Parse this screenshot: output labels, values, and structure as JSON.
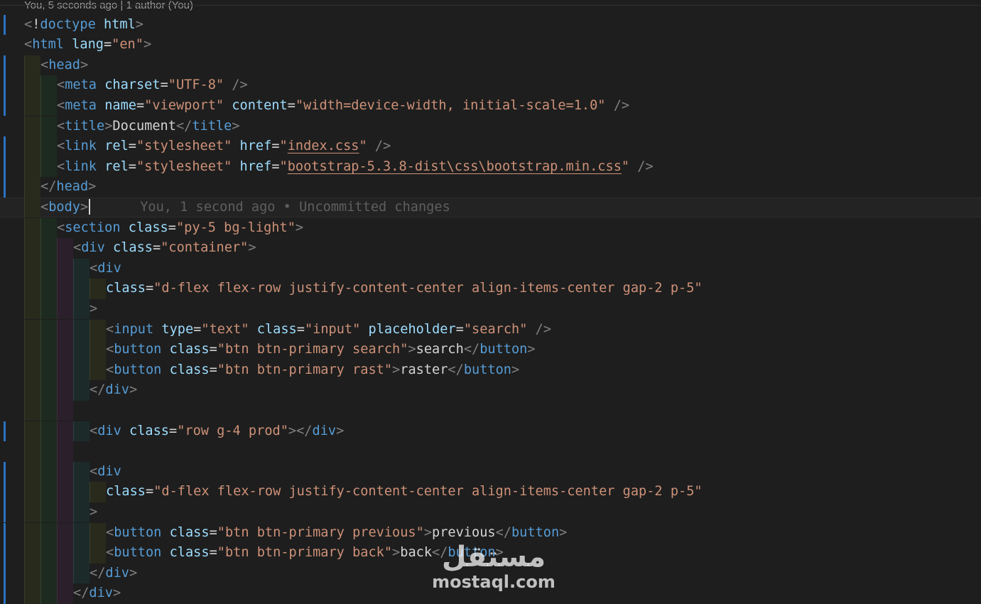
{
  "header_blame": "You, 5 seconds ago | 1 author (You)",
  "colors": {
    "background": "#1e1e1e",
    "tag": "#569cd6",
    "attribute": "#9cdcfe",
    "string": "#ce9178",
    "text": "#d4d4d4",
    "git_modified_gutter": "#2a73c2"
  },
  "inline_blame": "You, 1 second ago • Uncommitted changes",
  "lines": [
    {
      "indent": 0,
      "mark": true,
      "tokens": [
        [
          "p",
          "<"
        ],
        [
          "x",
          "!"
        ],
        [
          "t",
          "doctype"
        ],
        [
          "x",
          " "
        ],
        [
          "a",
          "html"
        ],
        [
          "p",
          ">"
        ]
      ]
    },
    {
      "indent": 0,
      "mark": false,
      "tokens": [
        [
          "p",
          "<"
        ],
        [
          "t",
          "html"
        ],
        [
          "x",
          " "
        ],
        [
          "a",
          "lang"
        ],
        [
          "x",
          "="
        ],
        [
          "s",
          "\"en\""
        ],
        [
          "p",
          ">"
        ]
      ]
    },
    {
      "indent": 1,
      "mark": true,
      "tokens": [
        [
          "p",
          "<"
        ],
        [
          "t",
          "head"
        ],
        [
          "p",
          ">"
        ]
      ]
    },
    {
      "indent": 2,
      "mark": true,
      "tokens": [
        [
          "p",
          "<"
        ],
        [
          "t",
          "meta"
        ],
        [
          "x",
          " "
        ],
        [
          "a",
          "charset"
        ],
        [
          "x",
          "="
        ],
        [
          "s",
          "\"UTF-8\""
        ],
        [
          "x",
          " "
        ],
        [
          "p",
          "/>"
        ]
      ]
    },
    {
      "indent": 2,
      "mark": true,
      "tokens": [
        [
          "p",
          "<"
        ],
        [
          "t",
          "meta"
        ],
        [
          "x",
          " "
        ],
        [
          "a",
          "name"
        ],
        [
          "x",
          "="
        ],
        [
          "s",
          "\"viewport\""
        ],
        [
          "x",
          " "
        ],
        [
          "a",
          "content"
        ],
        [
          "x",
          "="
        ],
        [
          "s",
          "\"width=device-width, initial-scale=1.0\""
        ],
        [
          "x",
          " "
        ],
        [
          "p",
          "/>"
        ]
      ]
    },
    {
      "indent": 2,
      "mark": false,
      "tokens": [
        [
          "p",
          "<"
        ],
        [
          "t",
          "title"
        ],
        [
          "p",
          ">"
        ],
        [
          "x",
          "Document"
        ],
        [
          "p",
          "</"
        ],
        [
          "t",
          "title"
        ],
        [
          "p",
          ">"
        ]
      ]
    },
    {
      "indent": 2,
      "mark": true,
      "tokens": [
        [
          "p",
          "<"
        ],
        [
          "t",
          "link"
        ],
        [
          "x",
          " "
        ],
        [
          "a",
          "rel"
        ],
        [
          "x",
          "="
        ],
        [
          "s",
          "\"stylesheet\""
        ],
        [
          "x",
          " "
        ],
        [
          "a",
          "href"
        ],
        [
          "x",
          "="
        ],
        [
          "s",
          "\""
        ],
        [
          "sl",
          "index.css"
        ],
        [
          "s",
          "\""
        ],
        [
          "x",
          " "
        ],
        [
          "p",
          "/>"
        ]
      ]
    },
    {
      "indent": 2,
      "mark": true,
      "tokens": [
        [
          "p",
          "<"
        ],
        [
          "t",
          "link"
        ],
        [
          "x",
          " "
        ],
        [
          "a",
          "rel"
        ],
        [
          "x",
          "="
        ],
        [
          "s",
          "\"stylesheet\""
        ],
        [
          "x",
          " "
        ],
        [
          "a",
          "href"
        ],
        [
          "x",
          "="
        ],
        [
          "s",
          "\""
        ],
        [
          "sl",
          "bootstrap-5.3.8-dist\\css\\bootstrap.min.css"
        ],
        [
          "s",
          "\""
        ],
        [
          "x",
          " "
        ],
        [
          "p",
          "/>"
        ]
      ]
    },
    {
      "indent": 1,
      "mark": true,
      "tokens": [
        [
          "p",
          "</"
        ],
        [
          "t",
          "head"
        ],
        [
          "p",
          ">"
        ]
      ]
    },
    {
      "indent": 1,
      "mark": false,
      "current": true,
      "tokens": [
        [
          "p",
          "<"
        ],
        [
          "t",
          "body"
        ],
        [
          "p",
          ">"
        ]
      ]
    },
    {
      "indent": 2,
      "mark": false,
      "tokens": [
        [
          "p",
          "<"
        ],
        [
          "t",
          "section"
        ],
        [
          "x",
          " "
        ],
        [
          "a",
          "class"
        ],
        [
          "x",
          "="
        ],
        [
          "s",
          "\"py-5 bg-light\""
        ],
        [
          "p",
          ">"
        ]
      ]
    },
    {
      "indent": 3,
      "mark": false,
      "tokens": [
        [
          "p",
          "<"
        ],
        [
          "t",
          "div"
        ],
        [
          "x",
          " "
        ],
        [
          "a",
          "class"
        ],
        [
          "x",
          "="
        ],
        [
          "s",
          "\"container\""
        ],
        [
          "p",
          ">"
        ]
      ]
    },
    {
      "indent": 4,
      "mark": false,
      "tokens": [
        [
          "p",
          "<"
        ],
        [
          "t",
          "div"
        ]
      ]
    },
    {
      "indent": 5,
      "mark": false,
      "tokens": [
        [
          "a",
          "class"
        ],
        [
          "x",
          "="
        ],
        [
          "s",
          "\"d-flex flex-row justify-content-center align-items-center gap-2 p-5\""
        ]
      ]
    },
    {
      "indent": 4,
      "mark": false,
      "tokens": [
        [
          "p",
          ">"
        ]
      ]
    },
    {
      "indent": 5,
      "mark": false,
      "tokens": [
        [
          "p",
          "<"
        ],
        [
          "t",
          "input"
        ],
        [
          "x",
          " "
        ],
        [
          "a",
          "type"
        ],
        [
          "x",
          "="
        ],
        [
          "s",
          "\"text\""
        ],
        [
          "x",
          " "
        ],
        [
          "a",
          "class"
        ],
        [
          "x",
          "="
        ],
        [
          "s",
          "\"input\""
        ],
        [
          "x",
          " "
        ],
        [
          "a",
          "placeholder"
        ],
        [
          "x",
          "="
        ],
        [
          "s",
          "\"search\""
        ],
        [
          "x",
          " "
        ],
        [
          "p",
          "/>"
        ]
      ]
    },
    {
      "indent": 5,
      "mark": false,
      "tokens": [
        [
          "p",
          "<"
        ],
        [
          "t",
          "button"
        ],
        [
          "x",
          " "
        ],
        [
          "a",
          "class"
        ],
        [
          "x",
          "="
        ],
        [
          "s",
          "\"btn btn-primary search\""
        ],
        [
          "p",
          ">"
        ],
        [
          "x",
          "search"
        ],
        [
          "p",
          "</"
        ],
        [
          "t",
          "button"
        ],
        [
          "p",
          ">"
        ]
      ]
    },
    {
      "indent": 5,
      "mark": false,
      "tokens": [
        [
          "p",
          "<"
        ],
        [
          "t",
          "button"
        ],
        [
          "x",
          " "
        ],
        [
          "a",
          "class"
        ],
        [
          "x",
          "="
        ],
        [
          "s",
          "\"btn btn-primary rast\""
        ],
        [
          "p",
          ">"
        ],
        [
          "x",
          "raster"
        ],
        [
          "p",
          "</"
        ],
        [
          "t",
          "button"
        ],
        [
          "p",
          ">"
        ]
      ]
    },
    {
      "indent": 4,
      "mark": false,
      "tokens": [
        [
          "p",
          "</"
        ],
        [
          "t",
          "div"
        ],
        [
          "p",
          ">"
        ]
      ]
    },
    {
      "indent": 3,
      "mark": false,
      "tokens": []
    },
    {
      "indent": 4,
      "mark": true,
      "tokens": [
        [
          "p",
          "<"
        ],
        [
          "t",
          "div"
        ],
        [
          "x",
          " "
        ],
        [
          "a",
          "class"
        ],
        [
          "x",
          "="
        ],
        [
          "s",
          "\"row g-4 prod\""
        ],
        [
          "p",
          "></"
        ],
        [
          "t",
          "div"
        ],
        [
          "p",
          ">"
        ]
      ]
    },
    {
      "indent": 3,
      "mark": false,
      "tokens": []
    },
    {
      "indent": 4,
      "mark": true,
      "tokens": [
        [
          "p",
          "<"
        ],
        [
          "t",
          "div"
        ]
      ]
    },
    {
      "indent": 5,
      "mark": true,
      "tokens": [
        [
          "a",
          "class"
        ],
        [
          "x",
          "="
        ],
        [
          "s",
          "\"d-flex flex-row justify-content-center align-items-center gap-2 p-5\""
        ]
      ]
    },
    {
      "indent": 4,
      "mark": true,
      "tokens": [
        [
          "p",
          ">"
        ]
      ]
    },
    {
      "indent": 5,
      "mark": true,
      "tokens": [
        [
          "p",
          "<"
        ],
        [
          "t",
          "button"
        ],
        [
          "x",
          " "
        ],
        [
          "a",
          "class"
        ],
        [
          "x",
          "="
        ],
        [
          "s",
          "\"btn btn-primary previous\""
        ],
        [
          "p",
          ">"
        ],
        [
          "x",
          "previous"
        ],
        [
          "p",
          "</"
        ],
        [
          "t",
          "button"
        ],
        [
          "p",
          ">"
        ]
      ]
    },
    {
      "indent": 5,
      "mark": true,
      "tokens": [
        [
          "p",
          "<"
        ],
        [
          "t",
          "button"
        ],
        [
          "x",
          " "
        ],
        [
          "a",
          "class"
        ],
        [
          "x",
          "="
        ],
        [
          "s",
          "\"btn btn-primary back\""
        ],
        [
          "p",
          ">"
        ],
        [
          "x",
          "back"
        ],
        [
          "p",
          "</"
        ],
        [
          "t",
          "button"
        ],
        [
          "p",
          ">"
        ]
      ]
    },
    {
      "indent": 4,
      "mark": true,
      "tokens": [
        [
          "p",
          "</"
        ],
        [
          "t",
          "div"
        ],
        [
          "p",
          ">"
        ]
      ]
    },
    {
      "indent": 3,
      "mark": true,
      "tokens": [
        [
          "p",
          "</"
        ],
        [
          "t",
          "div"
        ],
        [
          "p",
          ">"
        ]
      ]
    }
  ],
  "watermark": {
    "logo_text": "مستقل",
    "site": "mostaql.com"
  }
}
